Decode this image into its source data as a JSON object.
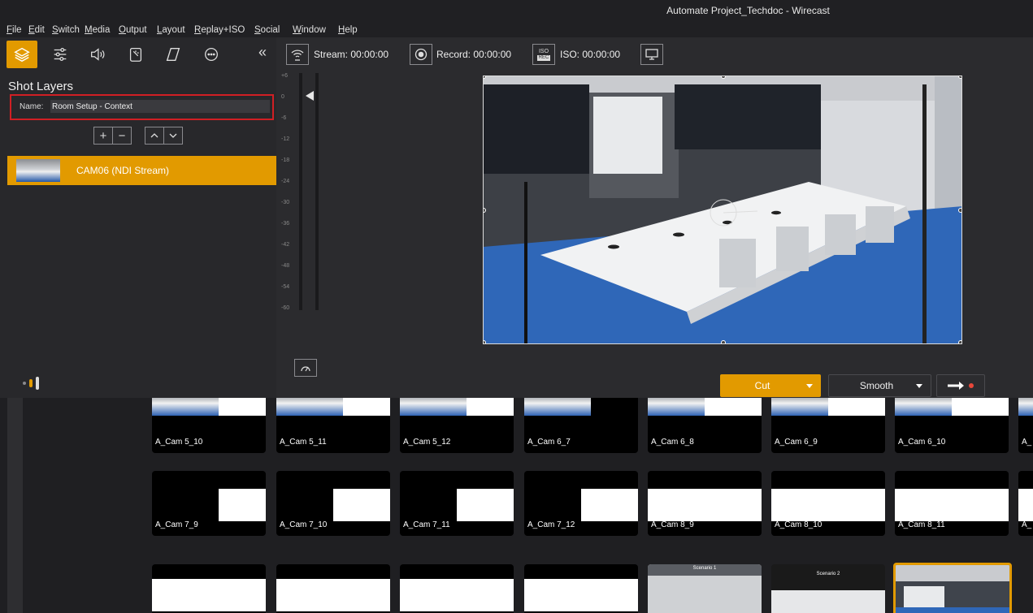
{
  "window": {
    "title": "Automate Project_Techdoc - Wirecast"
  },
  "menu": [
    "File",
    "Edit",
    "Switch",
    "Media",
    "Output",
    "Layout",
    "Replay+ISO",
    "Social",
    "Window",
    "Help"
  ],
  "tools": [
    {
      "icon": "layers-icon"
    },
    {
      "icon": "sliders-icon"
    },
    {
      "icon": "speaker-icon"
    },
    {
      "icon": "magic-wand-icon"
    },
    {
      "icon": "parallelogram-icon"
    },
    {
      "icon": "more-icon"
    }
  ],
  "panel": {
    "title": "Shot Layers",
    "name_label": "Name:",
    "name_value": "Room Setup - Context",
    "layer_name": "CAM06 (NDI Stream)"
  },
  "status": {
    "stream": "Stream: 00:00:00",
    "record": "Record: 00:00:00",
    "iso": "ISO: 00:00:00",
    "iso_badge_top": "ISO",
    "iso_badge_bottom": "REC"
  },
  "meter_labels": [
    "+6",
    "0",
    "-6",
    "-12",
    "-18",
    "-24",
    "-30",
    "-36",
    "-42",
    "-48",
    "-54",
    "-60"
  ],
  "transition": {
    "cut": "Cut",
    "smooth": "Smooth"
  },
  "colors": {
    "accent": "#e29a00",
    "highlight_red": "#d11f24"
  },
  "shots": {
    "row1": [
      "A_Cam 5_10",
      "A_Cam 5_11",
      "A_Cam 5_12",
      "A_Cam 6_7",
      "A_Cam 6_8",
      "A_Cam 6_9",
      "A_Cam 6_10",
      "A_"
    ],
    "row2": [
      "A_Cam 7_9",
      "A_Cam 7_10",
      "A_Cam 7_11",
      "A_Cam 7_12",
      "A_Cam 8_9",
      "A_Cam 8_10",
      "A_Cam 8_11",
      "A_"
    ],
    "row3_captions": [
      "Scenario 1",
      "Scenario 2"
    ]
  }
}
